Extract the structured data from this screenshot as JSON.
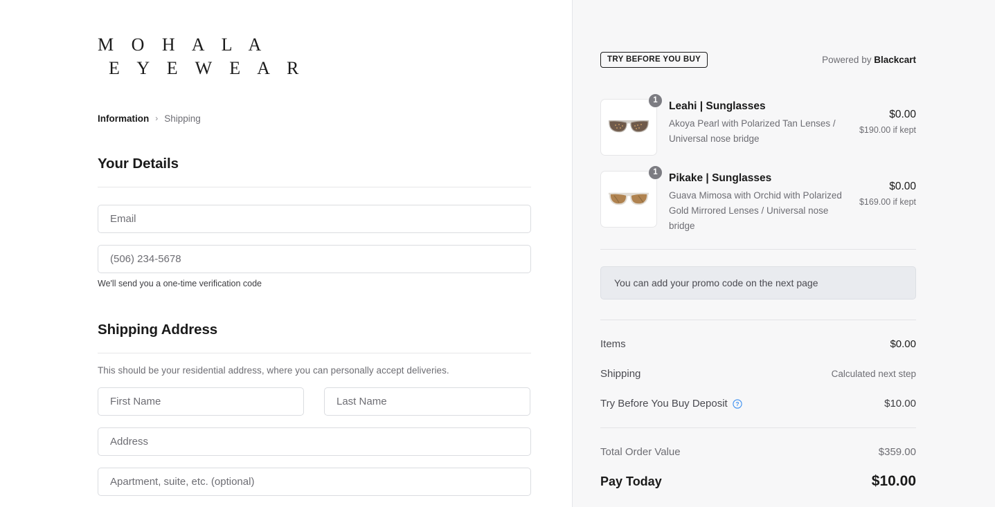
{
  "brand": {
    "line1": "M O H A L A",
    "line2": "E Y E W E A R"
  },
  "breadcrumb": {
    "current": "Information",
    "separator": "›",
    "next": "Shipping"
  },
  "details_section": {
    "title": "Your Details",
    "email_placeholder": "Email",
    "phone_placeholder": "(506) 234-5678",
    "phone_hint": "We'll send you a one-time verification code"
  },
  "shipping_section": {
    "title": "Shipping Address",
    "note": "This should be your residential address, where you can personally accept deliveries.",
    "first_name_placeholder": "First Name",
    "last_name_placeholder": "Last Name",
    "address_placeholder": "Address",
    "apartment_placeholder": "Apartment, suite, etc. (optional)"
  },
  "summary": {
    "badge": "TRY BEFORE YOU BUY",
    "powered_by_prefix": "Powered by ",
    "powered_by_brand": "Blackcart",
    "promo_note": "You can add your promo code on the next page",
    "items": [
      {
        "qty": "1",
        "name": "Leahi | Sunglasses",
        "variant": "Akoya Pearl with Polarized Tan Lenses / Universal nose bridge",
        "price_now": "$0.00",
        "price_if_kept": "$190.00 if kept",
        "thumb_icon": "sunglasses-icon",
        "lens_color": "#6f5a4b",
        "frame_color": "#cfcac4"
      },
      {
        "qty": "1",
        "name": "Pikake | Sunglasses",
        "variant": "Guava Mimosa with Orchid with Polarized Gold Mirrored Lenses / Universal nose bridge",
        "price_now": "$0.00",
        "price_if_kept": "$169.00 if kept",
        "thumb_icon": "sunglasses-icon",
        "lens_color": "#b08350",
        "frame_color": "#e6e1da"
      }
    ],
    "totals": {
      "items_label": "Items",
      "items_value": "$0.00",
      "shipping_label": "Shipping",
      "shipping_value": "Calculated next step",
      "deposit_label": "Try Before You Buy Deposit",
      "deposit_help_icon": "question-mark-circle-icon",
      "deposit_value": "$10.00",
      "order_value_label": "Total Order Value",
      "order_value_amount": "$359.00",
      "pay_today_label": "Pay Today",
      "pay_today_amount": "$10.00"
    }
  },
  "colors": {
    "accent_help": "#3b8ff0",
    "panel_bg": "#f7f7f8",
    "promo_bg": "#e9ebef",
    "text_dark": "#1a1a1a",
    "text_muted": "#6d6d73"
  }
}
